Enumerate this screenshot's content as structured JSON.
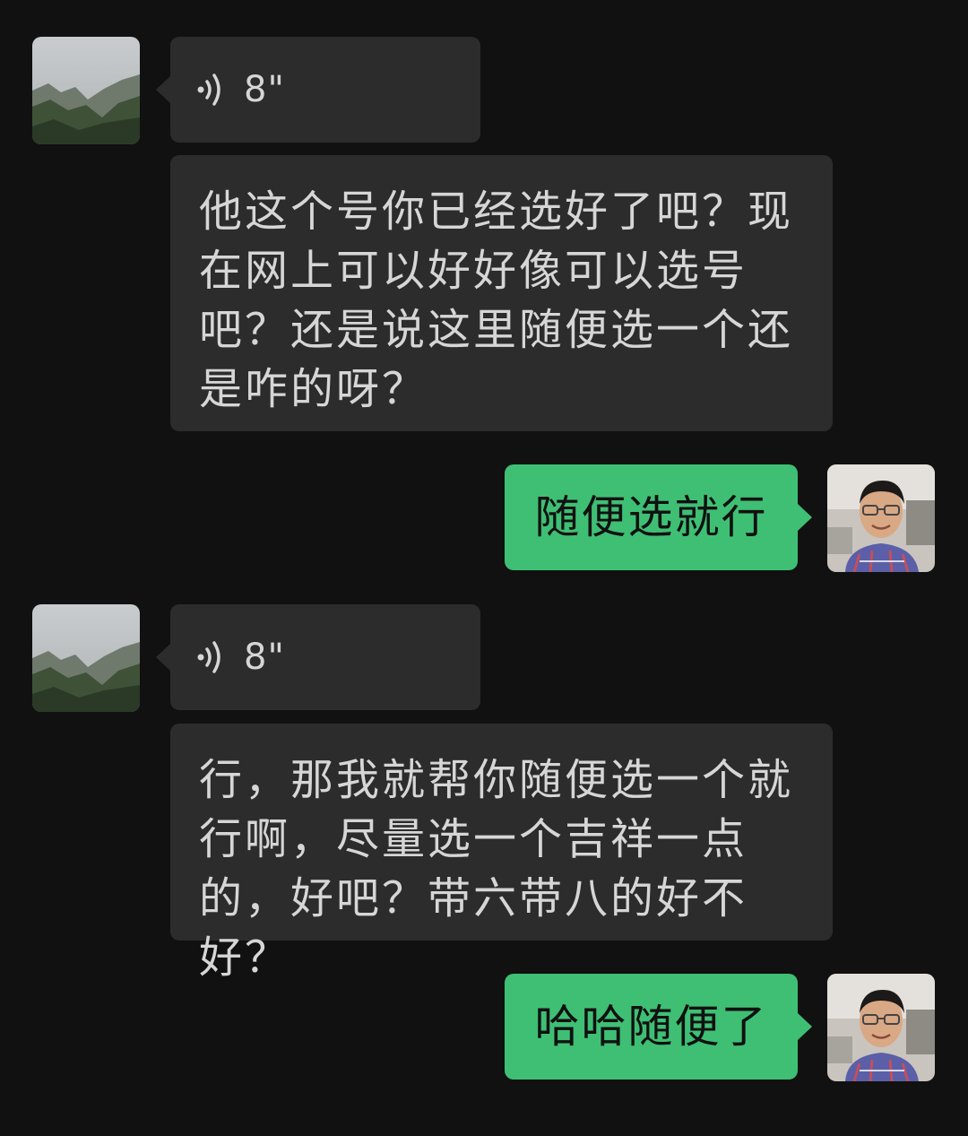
{
  "messages": [
    {
      "from": "contact",
      "type": "voice",
      "duration": "8\""
    },
    {
      "from": "contact",
      "type": "text",
      "text": "他这个号你已经选好了吧？现在网上可以好好像可以选号吧？还是说这里随便选一个还是咋的呀？"
    },
    {
      "from": "me",
      "type": "text",
      "text": "随便选就行"
    },
    {
      "from": "contact",
      "type": "voice",
      "duration": "8\""
    },
    {
      "from": "contact",
      "type": "text",
      "text": "行，那我就帮你随便选一个就行啊，尽量选一个吉祥一点的，好吧？带六带八的好不好？"
    },
    {
      "from": "me",
      "type": "text",
      "text": "哈哈随便了"
    }
  ],
  "colors": {
    "background": "#111111",
    "incoming_bubble": "#2c2c2c",
    "outgoing_bubble": "#3fbf74",
    "incoming_text": "#d6d6d6",
    "outgoing_text": "#111111"
  },
  "icons": {
    "voice": "voice-wave-icon",
    "contact_avatar": "misty-mountain-avatar",
    "my_avatar": "man-with-glasses-avatar"
  }
}
